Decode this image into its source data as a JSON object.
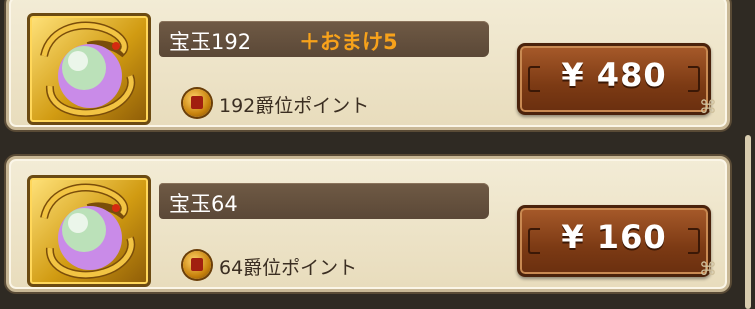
{
  "items": [
    {
      "name": "宝玉192",
      "bonus": "＋おまけ5",
      "points": "192爵位ポイント",
      "price": "¥ 480"
    },
    {
      "name": "宝玉64",
      "bonus": "",
      "points": "64爵位ポイント",
      "price": "¥ 160"
    }
  ],
  "icons": {
    "product": "dragon-orb-icon",
    "points": "rank-coin-icon",
    "ornament": "corner-knot-icon"
  },
  "colors": {
    "bonus_text": "#f7a21b",
    "price_button": "#7c3a14",
    "panel_bg": "#efe6cc"
  }
}
